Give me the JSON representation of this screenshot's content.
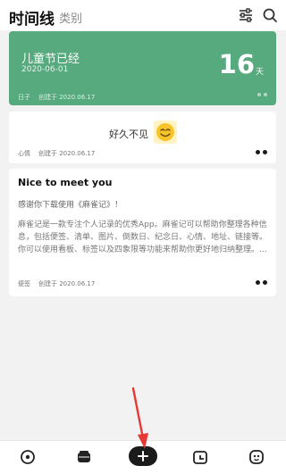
{
  "header": {
    "title": "时间线",
    "tab_category": "类别",
    "icons": [
      "filter-icon",
      "search-icon"
    ]
  },
  "cards": {
    "countdown": {
      "name": "儿童节已经",
      "date": "2020-06-01",
      "count": "16",
      "unit": "天",
      "type": "日子",
      "created": "创建于 2020.06.17",
      "color": "#57a97e"
    },
    "mood": {
      "text": "好久不见",
      "emoji": "smiling-face-icon",
      "type": "心情",
      "created": "创建于 2020.06.17"
    },
    "note": {
      "title": "Nice to meet you",
      "welcome": "感谢你下载使用《麻雀记》！",
      "body": "麻雀记是一款专注个人记录的优秀App。麻雀记可以帮助你整理各种信息，包括便签、清单、图片、倒数日、纪念日、心情、地址、链接等。你可以使用看板、标签以及四象限等功能来帮助你更好地归纳整理。...",
      "type": "便签",
      "created": "创建于 2020.06.17"
    }
  },
  "bottom_nav": [
    "timeline-icon",
    "board-icon",
    "add-icon",
    "calendar-icon",
    "profile-icon"
  ],
  "annotation": {
    "color": "#e53935"
  }
}
